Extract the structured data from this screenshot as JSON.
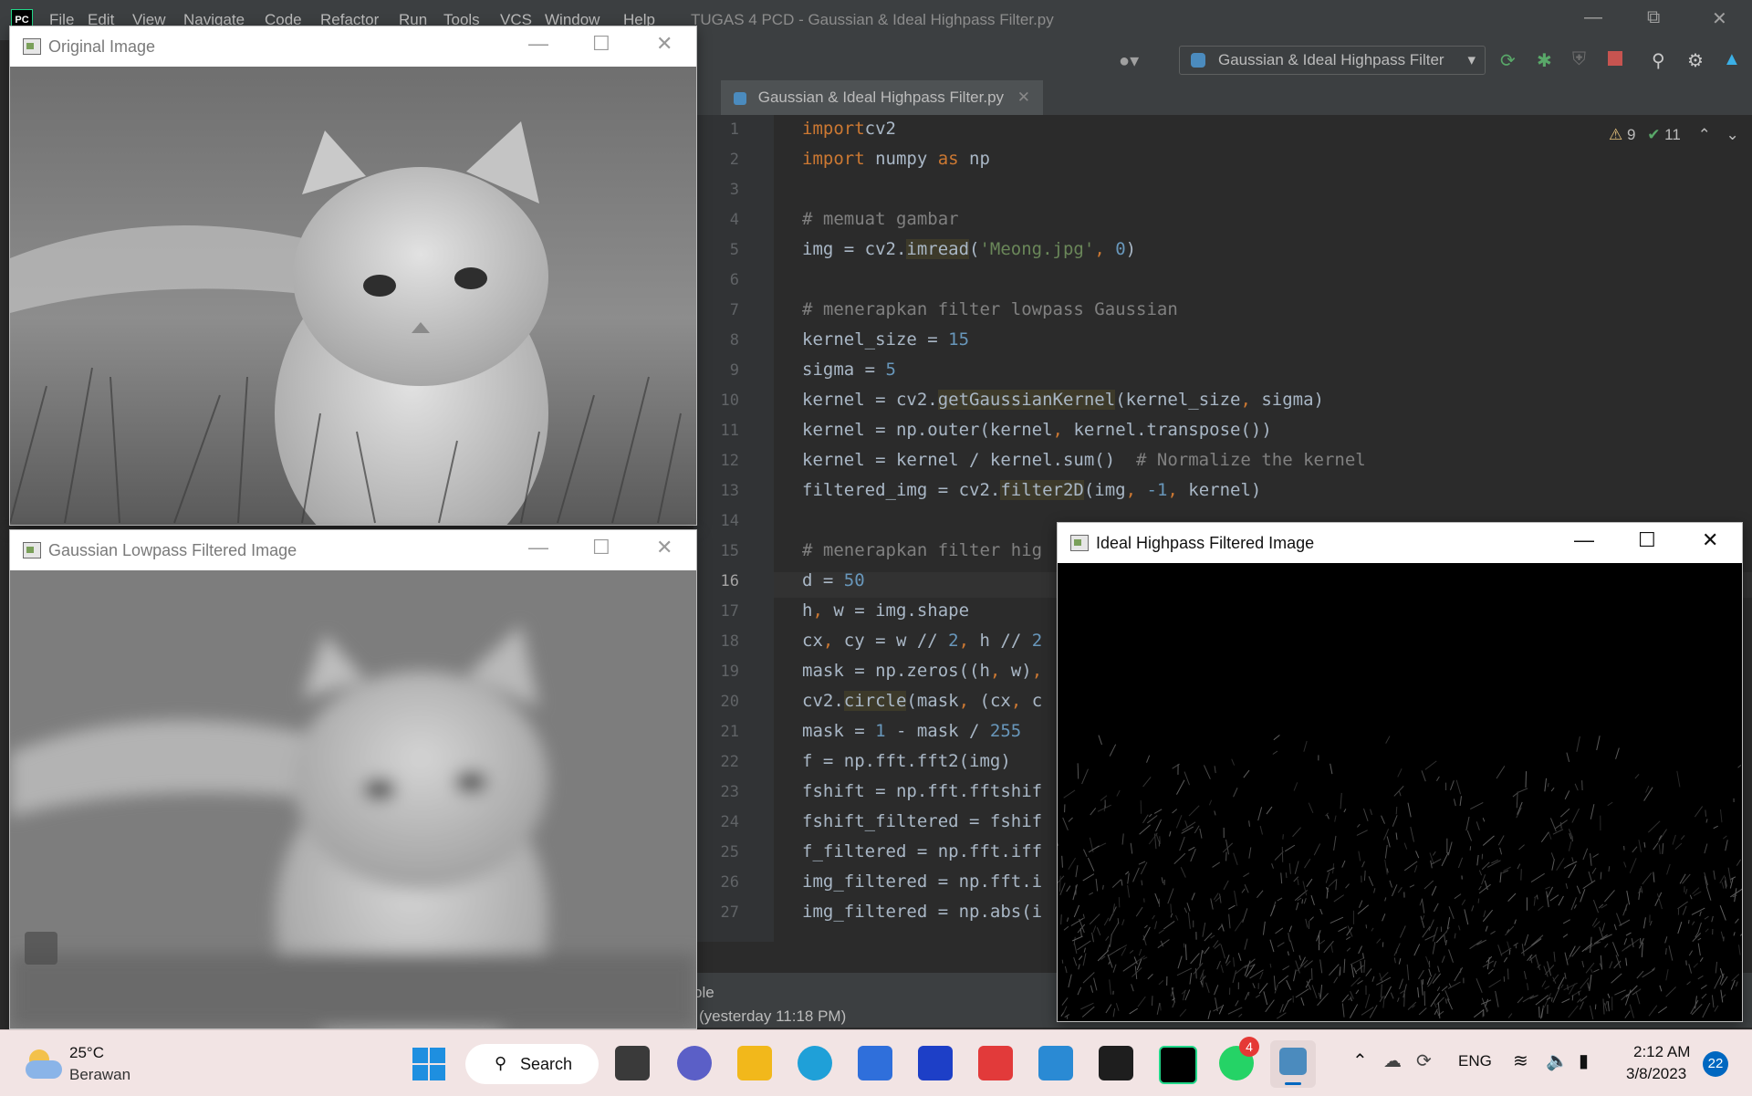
{
  "ide": {
    "menu": [
      "File",
      "Edit",
      "View",
      "Navigate",
      "Code",
      "Refactor",
      "Run",
      "Tools",
      "VCS",
      "Window",
      "Help"
    ],
    "title": "TUGAS 4 PCD - Gaussian & Ideal Highpass Filter.py",
    "run_config": "Gaussian & Ideal Highpass Filter",
    "tab_label": "Gaussian & Ideal Highpass Filter.py",
    "warnings": "9",
    "weak_warnings": "11",
    "status_fragment_1": "ole",
    "status_fragment_2": "(yesterday 11:18 PM)"
  },
  "code_lines": [
    {
      "n": "1",
      "segs": [
        [
          "kw",
          "import"
        ],
        [
          "",
          "cv2"
        ]
      ]
    },
    {
      "n": "2",
      "segs": [
        [
          "kw",
          "import"
        ],
        [
          "",
          " numpy "
        ],
        [
          "kw",
          "as"
        ],
        [
          "",
          " np"
        ]
      ]
    },
    {
      "n": "3",
      "segs": []
    },
    {
      "n": "4",
      "segs": [
        [
          "cmt",
          "# memuat gambar"
        ]
      ]
    },
    {
      "n": "5",
      "segs": [
        [
          "",
          "img = cv2."
        ],
        [
          "fn",
          "imread"
        ],
        [
          "",
          "("
        ],
        [
          "str",
          "'Meong.jpg'"
        ],
        [
          "kw",
          ", "
        ],
        [
          "num",
          "0"
        ],
        [
          "",
          ")"
        ]
      ]
    },
    {
      "n": "6",
      "segs": []
    },
    {
      "n": "7",
      "segs": [
        [
          "cmt",
          "# menerapkan filter lowpass Gaussian"
        ]
      ]
    },
    {
      "n": "8",
      "segs": [
        [
          "",
          "kernel_size = "
        ],
        [
          "num",
          "15"
        ]
      ]
    },
    {
      "n": "9",
      "segs": [
        [
          "",
          "sigma = "
        ],
        [
          "num",
          "5"
        ]
      ]
    },
    {
      "n": "10",
      "segs": [
        [
          "",
          "kernel = cv2."
        ],
        [
          "fn",
          "getGaussianKernel"
        ],
        [
          "",
          "(kernel_size"
        ],
        [
          "kw",
          ", "
        ],
        [
          "",
          "sigma)"
        ]
      ]
    },
    {
      "n": "11",
      "segs": [
        [
          "",
          "kernel = np.outer(kernel"
        ],
        [
          "kw",
          ", "
        ],
        [
          "",
          "kernel.transpose())"
        ]
      ]
    },
    {
      "n": "12",
      "segs": [
        [
          "",
          "kernel = kernel / kernel.sum()  "
        ],
        [
          "cmt",
          "# Normalize the kernel"
        ]
      ]
    },
    {
      "n": "13",
      "segs": [
        [
          "",
          "filtered_img = cv2."
        ],
        [
          "fn",
          "filter2D"
        ],
        [
          "",
          "(img"
        ],
        [
          "kw",
          ", "
        ],
        [
          "num",
          "-1"
        ],
        [
          "kw",
          ", "
        ],
        [
          "",
          "kernel)"
        ]
      ]
    },
    {
      "n": "14",
      "segs": []
    },
    {
      "n": "15",
      "segs": [
        [
          "cmt",
          "# menerapkan filter hig"
        ]
      ]
    },
    {
      "n": "16",
      "segs": [
        [
          "",
          "d = "
        ],
        [
          "num",
          "50"
        ]
      ]
    },
    {
      "n": "17",
      "segs": [
        [
          "",
          "h"
        ],
        [
          "kw",
          ", "
        ],
        [
          "",
          "w = img.shape"
        ]
      ]
    },
    {
      "n": "18",
      "segs": [
        [
          "",
          "cx"
        ],
        [
          "kw",
          ", "
        ],
        [
          "",
          "cy = w // "
        ],
        [
          "num",
          "2"
        ],
        [
          "kw",
          ", "
        ],
        [
          "",
          "h // "
        ],
        [
          "num",
          "2"
        ]
      ]
    },
    {
      "n": "19",
      "segs": [
        [
          "",
          "mask = np.zeros((h"
        ],
        [
          "kw",
          ", "
        ],
        [
          "",
          "w)"
        ],
        [
          "kw",
          ","
        ]
      ]
    },
    {
      "n": "20",
      "segs": [
        [
          "",
          "cv2."
        ],
        [
          "fn",
          "circle"
        ],
        [
          "",
          "(mask"
        ],
        [
          "kw",
          ", "
        ],
        [
          "",
          "(cx"
        ],
        [
          "kw",
          ", "
        ],
        [
          "",
          "c"
        ]
      ]
    },
    {
      "n": "21",
      "segs": [
        [
          "",
          "mask = "
        ],
        [
          "num",
          "1"
        ],
        [
          "",
          " - mask / "
        ],
        [
          "num",
          "255"
        ]
      ]
    },
    {
      "n": "22",
      "segs": [
        [
          "",
          "f = np.fft.fft2(img)"
        ]
      ]
    },
    {
      "n": "23",
      "segs": [
        [
          "",
          "fshift = np.fft.fftshif"
        ]
      ]
    },
    {
      "n": "24",
      "segs": [
        [
          "",
          "fshift_filtered = fshif"
        ]
      ]
    },
    {
      "n": "25",
      "segs": [
        [
          "",
          "f_filtered = np.fft.iff"
        ]
      ]
    },
    {
      "n": "26",
      "segs": [
        [
          "",
          "img_filtered = np.fft.i"
        ]
      ]
    },
    {
      "n": "27",
      "segs": [
        [
          "",
          "img_filtered = np.abs(i"
        ]
      ]
    }
  ],
  "windows": {
    "original": {
      "title": "Original Image"
    },
    "gaussian": {
      "title": "Gaussian Lowpass Filtered Image"
    },
    "highpass": {
      "title": "Ideal Highpass Filtered Image"
    }
  },
  "taskbar": {
    "temperature": "25°C",
    "weather": "Berawan",
    "search_label": "Search",
    "language": "ENG",
    "time": "2:12 AM",
    "date": "3/8/2023",
    "notifications": "22",
    "whatsapp_badge": "4"
  }
}
